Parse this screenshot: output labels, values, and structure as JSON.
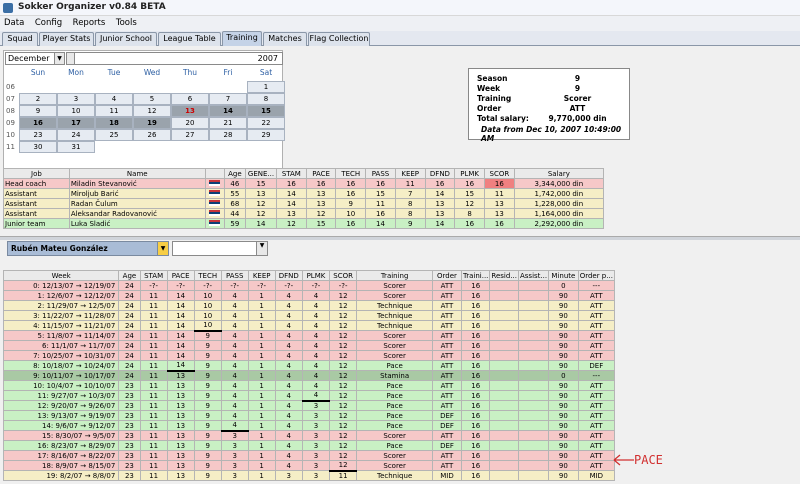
{
  "app": {
    "title": "Sokker Organizer v0.84 BETA"
  },
  "menu": [
    "Data",
    "Config",
    "Reports",
    "Tools"
  ],
  "tabs": [
    "Squad",
    "Player Stats",
    "Junior School",
    "League Table",
    "Training",
    "Matches",
    "Flag Collection"
  ],
  "active_tab": "Training",
  "calendar": {
    "month": "December",
    "year": "2007",
    "day_headers": [
      "Sun",
      "Mon",
      "Tue",
      "Wed",
      "Thu",
      "Fri",
      "Sat"
    ],
    "weeks": [
      {
        "wk": "06",
        "days": [
          "",
          "",
          "",
          "",
          "",
          "",
          "1"
        ]
      },
      {
        "wk": "07",
        "days": [
          "2",
          "3",
          "4",
          "5",
          "6",
          "7",
          "8"
        ]
      },
      {
        "wk": "08",
        "days": [
          "9",
          "10",
          "11",
          "12",
          "13",
          "14",
          "15"
        ]
      },
      {
        "wk": "09",
        "days": [
          "16",
          "17",
          "18",
          "19",
          "20",
          "21",
          "22"
        ]
      },
      {
        "wk": "10",
        "days": [
          "23",
          "24",
          "25",
          "26",
          "27",
          "28",
          "29"
        ]
      },
      {
        "wk": "11",
        "days": [
          "30",
          "31",
          "",
          "",
          "",
          "",
          ""
        ]
      }
    ]
  },
  "info": {
    "season_label": "Season",
    "season": "9",
    "week_label": "Week",
    "week": "9",
    "training_label": "Training",
    "training": "Scorer",
    "order_label": "Order",
    "order": "ATT",
    "salary_label": "Total salary:",
    "salary": "9,770,000 din",
    "data_from": "Data from Dec 10, 2007 10:49:00 AM"
  },
  "staff": {
    "headers": [
      "Job",
      "Name",
      "",
      "Age",
      "GENE...",
      "STAM",
      "PACE",
      "TECH",
      "PASS",
      "KEEP",
      "DFND",
      "PLMK",
      "SCOR",
      "Salary"
    ],
    "rows": [
      {
        "job": "Head coach",
        "name": "Miladin Stevanović",
        "age": "46",
        "gene": "15",
        "stam": "16",
        "pace": "16",
        "tech": "16",
        "pass": "16",
        "keep": "11",
        "dfnd": "16",
        "plmk": "16",
        "scor": "16",
        "salary": "3,344,000 din",
        "color": "#f6c8c8"
      },
      {
        "job": "Assistant",
        "name": "Miroljub Barić",
        "age": "55",
        "gene": "13",
        "stam": "14",
        "pace": "13",
        "tech": "16",
        "pass": "15",
        "keep": "7",
        "dfnd": "14",
        "plmk": "15",
        "scor": "11",
        "salary": "1,742,000 din",
        "color": "#f5eec6"
      },
      {
        "job": "Assistant",
        "name": "Radan Čulum",
        "age": "68",
        "gene": "12",
        "stam": "14",
        "pace": "13",
        "tech": "9",
        "pass": "11",
        "keep": "8",
        "dfnd": "13",
        "plmk": "12",
        "scor": "13",
        "salary": "1,228,000 din",
        "color": "#f5eec6"
      },
      {
        "job": "Assistant",
        "name": "Aleksandar Radovanović",
        "age": "44",
        "gene": "12",
        "stam": "13",
        "pace": "12",
        "tech": "10",
        "pass": "16",
        "keep": "8",
        "dfnd": "13",
        "plmk": "8",
        "scor": "13",
        "salary": "1,164,000 din",
        "color": "#f5eec6"
      },
      {
        "job": "Junior team",
        "name": "Luka Sladić",
        "age": "59",
        "gene": "14",
        "stam": "12",
        "pace": "15",
        "tech": "16",
        "pass": "14",
        "keep": "9",
        "dfnd": "14",
        "plmk": "16",
        "scor": "16",
        "salary": "2,292,000 din",
        "color": "#c9f0c4"
      }
    ]
  },
  "player": {
    "selected": "Rubén Mateu González",
    "second": ""
  },
  "history": {
    "headers": [
      "Week",
      "Age",
      "STAM",
      "PACE",
      "TECH",
      "PASS",
      "KEEP",
      "DFND",
      "PLMK",
      "SCOR",
      "Training",
      "Order",
      "Traini...",
      "Resid...",
      "Assist...",
      "Minute",
      "Order p..."
    ],
    "rows": [
      {
        "week": "0: 12/13/07 → 12/19/07",
        "age": "24",
        "stam": "-?-",
        "pace": "-?-",
        "tech": "-?-",
        "pass": "-?-",
        "keep": "-?-",
        "dfnd": "-?-",
        "plmk": "-?-",
        "scor": "-?-",
        "training": "Scorer",
        "order": "ATT",
        "traini": "16",
        "resid": "",
        "assist": "",
        "minute": "0",
        "orderp": "---",
        "color": "#f6c8c8"
      },
      {
        "week": "1: 12/6/07 → 12/12/07",
        "age": "24",
        "stam": "11",
        "pace": "14",
        "tech": "10",
        "pass": "4",
        "keep": "1",
        "dfnd": "4",
        "plmk": "4",
        "scor": "12",
        "training": "Scorer",
        "order": "ATT",
        "traini": "16",
        "resid": "",
        "assist": "",
        "minute": "90",
        "orderp": "ATT",
        "color": "#f6c8c8"
      },
      {
        "week": "2: 11/29/07 → 12/5/07",
        "age": "24",
        "stam": "11",
        "pace": "14",
        "tech": "10",
        "pass": "4",
        "keep": "1",
        "dfnd": "4",
        "plmk": "4",
        "scor": "12",
        "training": "Technique",
        "order": "ATT",
        "traini": "16",
        "resid": "",
        "assist": "",
        "minute": "90",
        "orderp": "ATT",
        "color": "#f5eec6"
      },
      {
        "week": "3: 11/22/07 → 11/28/07",
        "age": "24",
        "stam": "11",
        "pace": "14",
        "tech": "10",
        "pass": "4",
        "keep": "1",
        "dfnd": "4",
        "plmk": "4",
        "scor": "12",
        "training": "Technique",
        "order": "ATT",
        "traini": "16",
        "resid": "",
        "assist": "",
        "minute": "90",
        "orderp": "ATT",
        "color": "#f5eec6"
      },
      {
        "week": "4: 11/15/07 → 11/21/07",
        "age": "24",
        "stam": "11",
        "pace": "14",
        "tech": "10",
        "pass": "4",
        "keep": "1",
        "dfnd": "4",
        "plmk": "4",
        "scor": "12",
        "training": "Technique",
        "order": "ATT",
        "traini": "16",
        "resid": "",
        "assist": "",
        "minute": "90",
        "orderp": "ATT",
        "color": "#f5eec6"
      },
      {
        "week": "5: 11/8/07 → 11/14/07",
        "age": "24",
        "stam": "11",
        "pace": "14",
        "tech": "9",
        "pass": "4",
        "keep": "1",
        "dfnd": "4",
        "plmk": "4",
        "scor": "12",
        "training": "Scorer",
        "order": "ATT",
        "traini": "16",
        "resid": "",
        "assist": "",
        "minute": "90",
        "orderp": "ATT",
        "color": "#f6c8c8"
      },
      {
        "week": "6: 11/1/07 → 11/7/07",
        "age": "24",
        "stam": "11",
        "pace": "14",
        "tech": "9",
        "pass": "4",
        "keep": "1",
        "dfnd": "4",
        "plmk": "4",
        "scor": "12",
        "training": "Scorer",
        "order": "ATT",
        "traini": "16",
        "resid": "",
        "assist": "",
        "minute": "90",
        "orderp": "ATT",
        "color": "#f6c8c8"
      },
      {
        "week": "7: 10/25/07 → 10/31/07",
        "age": "24",
        "stam": "11",
        "pace": "14",
        "tech": "9",
        "pass": "4",
        "keep": "1",
        "dfnd": "4",
        "plmk": "4",
        "scor": "12",
        "training": "Scorer",
        "order": "ATT",
        "traini": "16",
        "resid": "",
        "assist": "",
        "minute": "90",
        "orderp": "ATT",
        "color": "#f6c8c8"
      },
      {
        "week": "8: 10/18/07 → 10/24/07",
        "age": "24",
        "stam": "11",
        "pace": "14",
        "tech": "9",
        "pass": "4",
        "keep": "1",
        "dfnd": "4",
        "plmk": "4",
        "scor": "12",
        "training": "Pace",
        "order": "ATT",
        "traini": "16",
        "resid": "",
        "assist": "",
        "minute": "90",
        "orderp": "DEF",
        "color": "#c9f0c4"
      },
      {
        "week": "9: 10/11/07 → 10/17/07",
        "age": "24",
        "stam": "11",
        "pace": "13",
        "tech": "9",
        "pass": "4",
        "keep": "1",
        "dfnd": "4",
        "plmk": "4",
        "scor": "12",
        "training": "Stamina",
        "order": "ATT",
        "traini": "16",
        "resid": "",
        "assist": "",
        "minute": "0",
        "orderp": "---",
        "color": "#a9c9a4"
      },
      {
        "week": "10: 10/4/07 → 10/10/07",
        "age": "23",
        "stam": "11",
        "pace": "13",
        "tech": "9",
        "pass": "4",
        "keep": "1",
        "dfnd": "4",
        "plmk": "4",
        "scor": "12",
        "training": "Pace",
        "order": "ATT",
        "traini": "16",
        "resid": "",
        "assist": "",
        "minute": "90",
        "orderp": "ATT",
        "color": "#c9f0c4"
      },
      {
        "week": "11: 9/27/07 → 10/3/07",
        "age": "23",
        "stam": "11",
        "pace": "13",
        "tech": "9",
        "pass": "4",
        "keep": "1",
        "dfnd": "4",
        "plmk": "4",
        "scor": "12",
        "training": "Pace",
        "order": "ATT",
        "traini": "16",
        "resid": "",
        "assist": "",
        "minute": "90",
        "orderp": "ATT",
        "color": "#c9f0c4"
      },
      {
        "week": "12: 9/20/07 → 9/26/07",
        "age": "23",
        "stam": "11",
        "pace": "13",
        "tech": "9",
        "pass": "4",
        "keep": "1",
        "dfnd": "4",
        "plmk": "3",
        "scor": "12",
        "training": "Pace",
        "order": "ATT",
        "traini": "16",
        "resid": "",
        "assist": "",
        "minute": "90",
        "orderp": "ATT",
        "color": "#c9f0c4"
      },
      {
        "week": "13: 9/13/07 → 9/19/07",
        "age": "23",
        "stam": "11",
        "pace": "13",
        "tech": "9",
        "pass": "4",
        "keep": "1",
        "dfnd": "4",
        "plmk": "3",
        "scor": "12",
        "training": "Pace",
        "order": "DEF",
        "traini": "16",
        "resid": "",
        "assist": "",
        "minute": "90",
        "orderp": "ATT",
        "color": "#c9f0c4"
      },
      {
        "week": "14: 9/6/07 → 9/12/07",
        "age": "23",
        "stam": "11",
        "pace": "13",
        "tech": "9",
        "pass": "4",
        "keep": "1",
        "dfnd": "4",
        "plmk": "3",
        "scor": "12",
        "training": "Pace",
        "order": "DEF",
        "traini": "16",
        "resid": "",
        "assist": "",
        "minute": "90",
        "orderp": "ATT",
        "color": "#c9f0c4"
      },
      {
        "week": "15: 8/30/07 → 9/5/07",
        "age": "23",
        "stam": "11",
        "pace": "13",
        "tech": "9",
        "pass": "3",
        "keep": "1",
        "dfnd": "4",
        "plmk": "3",
        "scor": "12",
        "training": "Scorer",
        "order": "ATT",
        "traini": "16",
        "resid": "",
        "assist": "",
        "minute": "90",
        "orderp": "ATT",
        "color": "#f6c8c8"
      },
      {
        "week": "16: 8/23/07 → 8/29/07",
        "age": "23",
        "stam": "11",
        "pace": "13",
        "tech": "9",
        "pass": "3",
        "keep": "1",
        "dfnd": "4",
        "plmk": "3",
        "scor": "12",
        "training": "Pace",
        "order": "DEF",
        "traini": "16",
        "resid": "",
        "assist": "",
        "minute": "90",
        "orderp": "ATT",
        "color": "#c9f0c4"
      },
      {
        "week": "17: 8/16/07 → 8/22/07",
        "age": "23",
        "stam": "11",
        "pace": "13",
        "tech": "9",
        "pass": "3",
        "keep": "1",
        "dfnd": "4",
        "plmk": "3",
        "scor": "12",
        "training": "Scorer",
        "order": "ATT",
        "traini": "16",
        "resid": "",
        "assist": "",
        "minute": "90",
        "orderp": "ATT",
        "color": "#f6c8c8"
      },
      {
        "week": "18: 8/9/07 → 8/15/07",
        "age": "23",
        "stam": "11",
        "pace": "13",
        "tech": "9",
        "pass": "3",
        "keep": "1",
        "dfnd": "4",
        "plmk": "3",
        "scor": "12",
        "training": "Scorer",
        "order": "ATT",
        "traini": "16",
        "resid": "",
        "assist": "",
        "minute": "90",
        "orderp": "ATT",
        "color": "#f6c8c8"
      },
      {
        "week": "19: 8/2/07 → 8/8/07",
        "age": "23",
        "stam": "11",
        "pace": "13",
        "tech": "9",
        "pass": "3",
        "keep": "1",
        "dfnd": "3",
        "plmk": "3",
        "scor": "11",
        "training": "Technique",
        "order": "MID",
        "traini": "16",
        "resid": "",
        "assist": "",
        "minute": "90",
        "orderp": "MID",
        "color": "#f5eec6"
      }
    ]
  },
  "annotation": {
    "text": "PACE",
    "color": "#d13030"
  }
}
